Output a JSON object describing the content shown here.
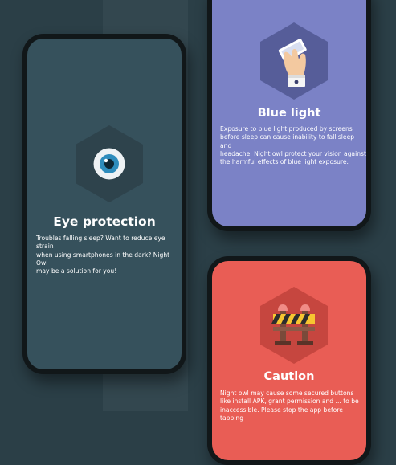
{
  "cards": [
    {
      "id": "eye-protection",
      "title": "Eye protection",
      "body_lines": [
        "Troubles falling sleep? Want to reduce eye strain",
        "when using smartphones in the dark? Night Owl",
        "may be a solution for you!"
      ],
      "icon": "eye-icon",
      "background": "#36515c"
    },
    {
      "id": "blue-light",
      "title": "Blue light",
      "body_lines": [
        "Exposure to blue light produced by screens",
        "before sleep can cause inability to fall sleep and",
        "headache. Night owl protect your vision against",
        "the harmful effects of blue light exposure."
      ],
      "icon": "hand-holding-phone-icon",
      "background": "#7b82c6"
    },
    {
      "id": "caution",
      "title": "Caution",
      "body_lines": [
        "Night owl may cause some secured buttons",
        "like install APK, grant permission and ... to be",
        "inaccessible. Please stop the app before tapping"
      ],
      "icon": "road-barrier-icon",
      "background": "#e95d55"
    }
  ]
}
